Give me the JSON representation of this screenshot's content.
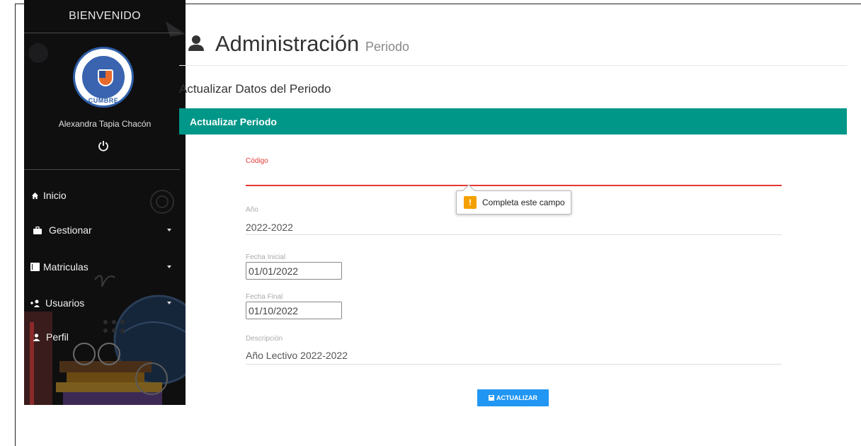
{
  "sidebar": {
    "title": "BIENVENIDO",
    "logo_text": "CUMBRE",
    "user_name": "Alexandra Tapia Chacón",
    "items": [
      {
        "label": "Inicio",
        "icon": "home-icon",
        "has_caret": false
      },
      {
        "label": "Gestionar",
        "icon": "briefcase-icon",
        "has_caret": true
      },
      {
        "label": "Matriculas",
        "icon": "book-icon",
        "has_caret": true
      },
      {
        "label": "Usuarios",
        "icon": "add-user-icon",
        "has_caret": true
      },
      {
        "label": "Perfil",
        "icon": "person-icon",
        "has_caret": false
      }
    ]
  },
  "header": {
    "title": "Administración",
    "subtitle": "Periodo"
  },
  "section_title": "Actualizar Datos del Periodo",
  "panel": {
    "title": "Actualizar Periodo"
  },
  "form": {
    "codigo": {
      "label": "Código",
      "value": ""
    },
    "anio": {
      "label": "Año",
      "value": "2022-2022"
    },
    "fecha_inicial": {
      "label": "Fecha Inicial",
      "value": "01/01/2022"
    },
    "fecha_final": {
      "label": "Fecha Final",
      "value": "01/10/2022"
    },
    "descripcion": {
      "label": "Descripción",
      "value": "Año Lectivo 2022-2022"
    },
    "submit_label": "ACTUALIZAR"
  },
  "validation_tooltip": {
    "icon": "!",
    "message": "Completa este campo"
  },
  "colors": {
    "panel_header": "#009688",
    "button": "#2196f3",
    "error": "#e53935",
    "warning": "#f4a000",
    "sidebar_bg": "#0f0f10"
  }
}
